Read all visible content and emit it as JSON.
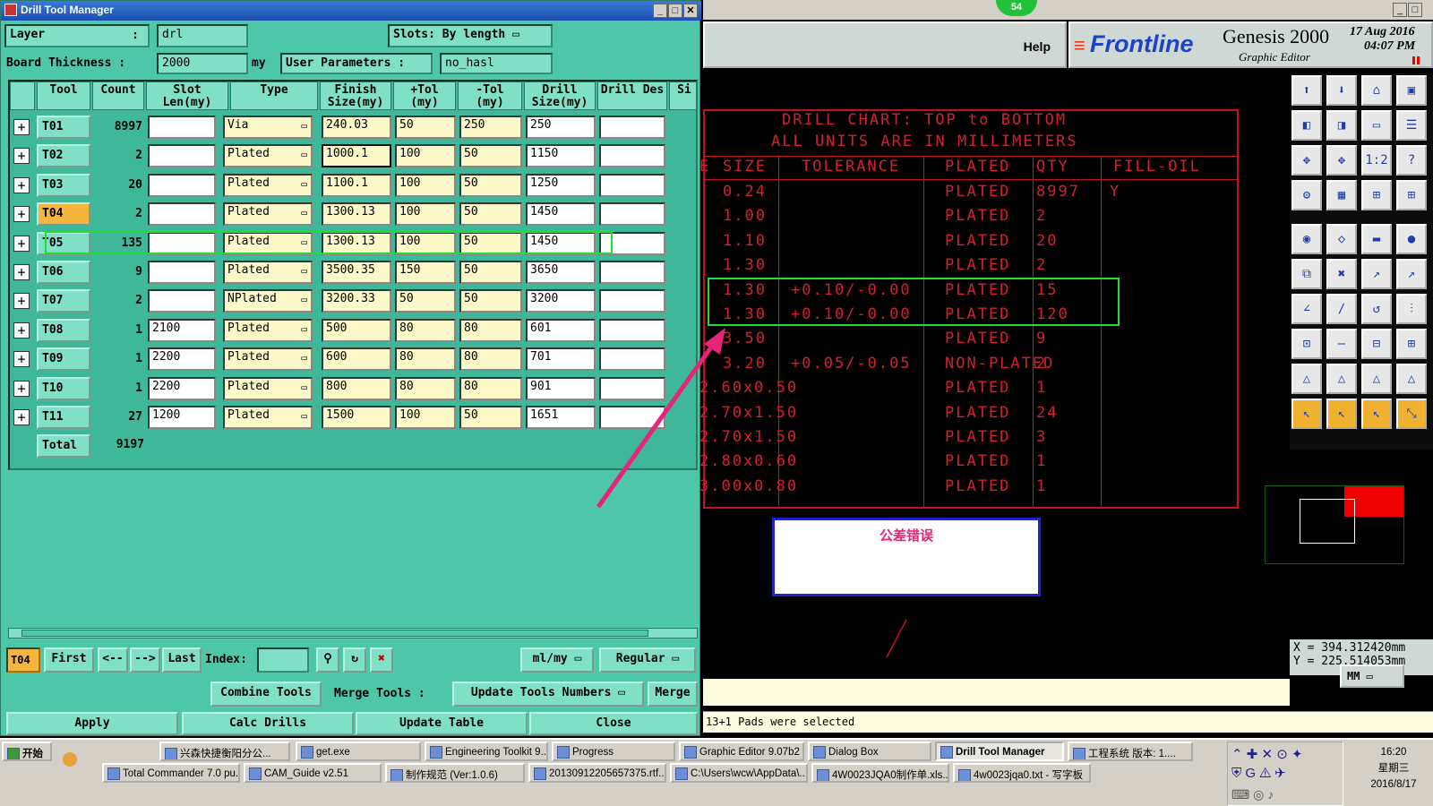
{
  "window": {
    "title": "Drill Tool Manager",
    "min": "_",
    "max": "□",
    "close": "✕"
  },
  "form": {
    "layer_label": "Layer",
    "layer_sep": ":",
    "layer_value": "drl",
    "slots_label": "Slots:",
    "slots_value": "By length",
    "board_thickness_label": "Board Thickness :",
    "board_thickness_value": "2000",
    "board_unit": "my",
    "user_params_label": "User Parameters :",
    "user_params_value": "no_hasl"
  },
  "columns": [
    "Tool",
    "Count",
    "Slot Len(my)",
    "Type",
    "Finish Size(my)",
    "+Tol (my)",
    "-Tol (my)",
    "Drill Size(my)",
    "Drill Des",
    "Si"
  ],
  "rows": [
    {
      "tool": "T01",
      "count": "8997",
      "slot": "",
      "type": "Via",
      "finish": "240.03",
      "ptol": "50",
      "mtol": "250",
      "drill": "250"
    },
    {
      "tool": "T02",
      "count": "2",
      "slot": "",
      "type": "Plated",
      "finish": "1000.1",
      "ptol": "100",
      "mtol": "50",
      "drill": "1150"
    },
    {
      "tool": "T03",
      "count": "20",
      "slot": "",
      "type": "Plated",
      "finish": "1100.1",
      "ptol": "100",
      "mtol": "50",
      "drill": "1250"
    },
    {
      "tool": "T04",
      "count": "2",
      "slot": "",
      "type": "Plated",
      "finish": "1300.13",
      "ptol": "100",
      "mtol": "50",
      "drill": "1450"
    },
    {
      "tool": "T05",
      "count": "135",
      "slot": "",
      "type": "Plated",
      "finish": "1300.13",
      "ptol": "100",
      "mtol": "50",
      "drill": "1450"
    },
    {
      "tool": "T06",
      "count": "9",
      "slot": "",
      "type": "Plated",
      "finish": "3500.35",
      "ptol": "150",
      "mtol": "50",
      "drill": "3650"
    },
    {
      "tool": "T07",
      "count": "2",
      "slot": "",
      "type": "NPlated",
      "finish": "3200.33",
      "ptol": "50",
      "mtol": "50",
      "drill": "3200"
    },
    {
      "tool": "T08",
      "count": "1",
      "slot": "2100",
      "type": "Plated",
      "finish": "500",
      "ptol": "80",
      "mtol": "80",
      "drill": "601"
    },
    {
      "tool": "T09",
      "count": "1",
      "slot": "2200",
      "type": "Plated",
      "finish": "600",
      "ptol": "80",
      "mtol": "80",
      "drill": "701"
    },
    {
      "tool": "T10",
      "count": "1",
      "slot": "2200",
      "type": "Plated",
      "finish": "800",
      "ptol": "80",
      "mtol": "80",
      "drill": "901"
    },
    {
      "tool": "T11",
      "count": "27",
      "slot": "1200",
      "type": "Plated",
      "finish": "1500",
      "ptol": "100",
      "mtol": "50",
      "drill": "1651"
    }
  ],
  "total": {
    "label": "Total",
    "value": "9197"
  },
  "nav": {
    "current": "T04",
    "first": "First",
    "prev": "<--",
    "next": "-->",
    "last": "Last",
    "index_label": "Index:",
    "units": "ml/my",
    "mode": "Regular"
  },
  "actions": {
    "combine": "Combine Tools",
    "merge_label": "Merge Tools :",
    "update_numbers": "Update Tools Numbers",
    "merge": "Merge",
    "apply": "Apply",
    "calc": "Calc Drills",
    "update_table": "Update Table",
    "close": "Close"
  },
  "graphic": {
    "badge": "54",
    "help": "Help",
    "brand": "Frontline",
    "product": "Genesis 2000",
    "subtitle": "Graphic Editor",
    "date": "17 Aug 2016",
    "time": "04:07 PM"
  },
  "drill_chart": {
    "title1": "DRILL CHART: TOP to BOTTOM",
    "title2": "ALL UNITS ARE IN MILLIMETERS",
    "headers": [
      "E",
      "SIZE",
      "TOLERANCE",
      "PLATED",
      "QTY",
      "FILL-OIL"
    ],
    "rows": [
      [
        "0.24",
        "",
        "PLATED",
        "8997",
        "Y"
      ],
      [
        "1.00",
        "",
        "PLATED",
        "2",
        ""
      ],
      [
        "1.10",
        "",
        "PLATED",
        "20",
        ""
      ],
      [
        "1.30",
        "",
        "PLATED",
        "2",
        ""
      ],
      [
        "1.30",
        "+0.10/-0.00",
        "PLATED",
        "15",
        ""
      ],
      [
        "1.30",
        "+0.10/-0.00",
        "PLATED",
        "120",
        ""
      ],
      [
        "3.50",
        "",
        "PLATED",
        "9",
        ""
      ],
      [
        "3.20",
        "+0.05/-0.05",
        "NON-PLATED",
        "2",
        ""
      ],
      [
        "2.60x0.50",
        "",
        "PLATED",
        "1",
        ""
      ],
      [
        "2.70x1.50",
        "",
        "PLATED",
        "24",
        ""
      ],
      [
        "2.70x1.50",
        "",
        "PLATED",
        "3",
        ""
      ],
      [
        "2.80x0.60",
        "",
        "PLATED",
        "1",
        ""
      ],
      [
        "3.00x0.80",
        "",
        "PLATED",
        "1",
        ""
      ]
    ]
  },
  "annotation": {
    "text": "公差错误",
    "arrow_color": "#e8247a",
    "highlight_color": "#22dd33"
  },
  "coords": {
    "x": "X = 394.312420mm",
    "y": "Y = 225.514053mm",
    "unit": "MM"
  },
  "status": "13+1 Pads were selected",
  "taskbar": {
    "start": "开始",
    "row1": [
      "兴森快捷衡阳分公...",
      "get.exe",
      "Engineering Toolkit 9....",
      "Progress",
      "Graphic Editor 9.07b2 ...",
      "Dialog Box",
      "Drill Tool Manager",
      "工程系统  版本: 1...."
    ],
    "row2": [
      "Total Commander 7.0 pu...",
      "CAM_Guide v2.51",
      "制作规范 (Ver:1.0.6)",
      "20130912205657375.rtf...",
      "C:\\Users\\wcw\\AppData\\...",
      "4W0023JQA0制作单.xls...",
      "4w0023jqa0.txt - 写字板"
    ],
    "clock_time": "16:20",
    "clock_day": "星期三",
    "clock_date": "2016/8/17"
  }
}
